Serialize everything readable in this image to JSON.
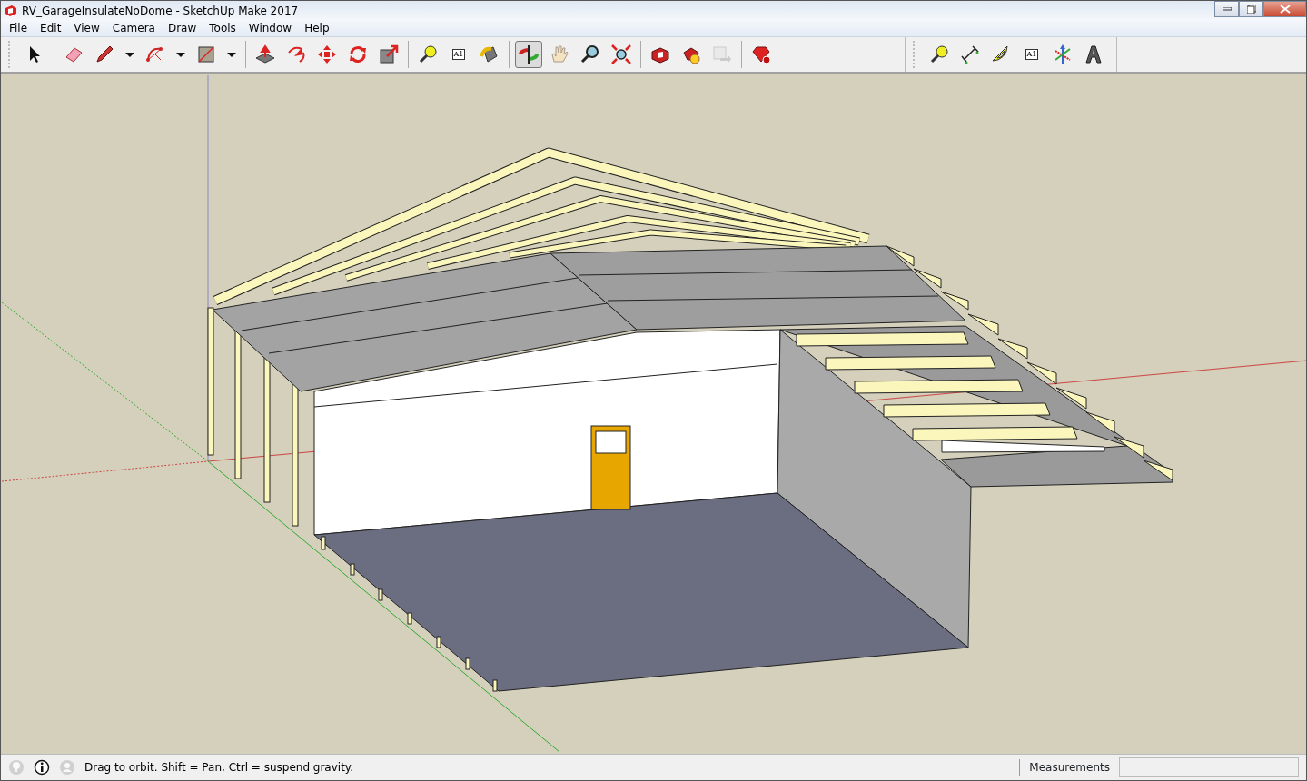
{
  "window": {
    "title": "RV_GarageInsulateNoDome - SketchUp Make 2017"
  },
  "menu": [
    {
      "label": "File"
    },
    {
      "label": "Edit"
    },
    {
      "label": "View"
    },
    {
      "label": "Camera"
    },
    {
      "label": "Draw"
    },
    {
      "label": "Tools"
    },
    {
      "label": "Window"
    },
    {
      "label": "Help"
    }
  ],
  "toolbars": [
    {
      "groups": [
        [
          {
            "kind": "select",
            "selected": false,
            "disabled": false
          }
        ],
        [
          {
            "kind": "eraser",
            "selected": false,
            "disabled": false
          },
          {
            "kind": "pencil",
            "selected": false,
            "disabled": false
          },
          {
            "kind": "caret",
            "selected": false,
            "disabled": false
          },
          {
            "kind": "arc",
            "selected": false,
            "disabled": false
          },
          {
            "kind": "caret",
            "selected": false,
            "disabled": false
          },
          {
            "kind": "rectangle",
            "selected": false,
            "disabled": false
          },
          {
            "kind": "caret",
            "selected": false,
            "disabled": false
          }
        ],
        [
          {
            "kind": "pushpull",
            "selected": false,
            "disabled": false
          },
          {
            "kind": "followme",
            "selected": false,
            "disabled": false
          },
          {
            "kind": "move",
            "selected": false,
            "disabled": false
          },
          {
            "kind": "rotate",
            "selected": false,
            "disabled": false
          },
          {
            "kind": "scale",
            "selected": false,
            "disabled": false
          }
        ],
        [
          {
            "kind": "tape",
            "selected": false,
            "disabled": false
          },
          {
            "kind": "text",
            "label": "A1",
            "selected": false,
            "disabled": false
          },
          {
            "kind": "paint",
            "selected": false,
            "disabled": false
          }
        ],
        [
          {
            "kind": "orbit",
            "selected": true,
            "disabled": false
          },
          {
            "kind": "pan",
            "selected": false,
            "disabled": false
          },
          {
            "kind": "zoom",
            "selected": false,
            "disabled": false
          },
          {
            "kind": "extents",
            "selected": false,
            "disabled": false
          }
        ],
        [
          {
            "kind": "warehouse",
            "selected": false,
            "disabled": false
          },
          {
            "kind": "extensions",
            "selected": false,
            "disabled": false
          },
          {
            "kind": "share",
            "selected": false,
            "disabled": true
          }
        ],
        [
          {
            "kind": "ruby",
            "selected": false,
            "disabled": false
          }
        ]
      ]
    },
    {
      "groups": [
        [
          {
            "kind": "tape",
            "selected": false,
            "disabled": false
          },
          {
            "kind": "dimension",
            "selected": false,
            "disabled": false
          },
          {
            "kind": "protractor",
            "selected": false,
            "disabled": false
          },
          {
            "kind": "text",
            "label": "A1",
            "selected": false,
            "disabled": false
          },
          {
            "kind": "axes",
            "selected": false,
            "disabled": false
          },
          {
            "kind": "text3d",
            "selected": false,
            "disabled": false
          }
        ]
      ]
    }
  ],
  "status_bar": {
    "icons": [
      {
        "kind": "geo",
        "disabled": true
      },
      {
        "kind": "info",
        "disabled": false
      },
      {
        "kind": "user",
        "disabled": true
      }
    ],
    "message": "Drag to orbit. Shift = Pan, Ctrl = suspend gravity.",
    "measurements_label": "Measurements"
  }
}
